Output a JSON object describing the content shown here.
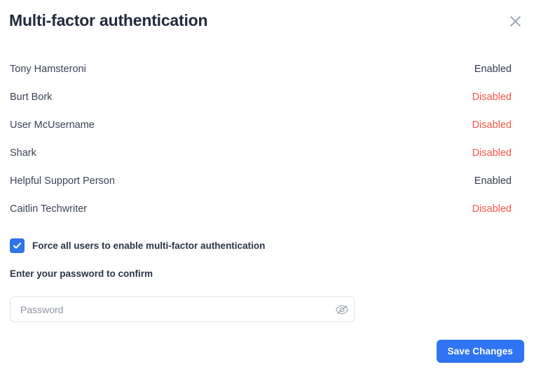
{
  "dialog": {
    "title": "Multi-factor authentication",
    "close_icon": "close-icon"
  },
  "users": [
    {
      "name": "Tony Hamsteroni",
      "status": "Enabled",
      "state": "enabled"
    },
    {
      "name": "Burt Bork",
      "status": "Disabled",
      "state": "disabled"
    },
    {
      "name": "User McUsername",
      "status": "Disabled",
      "state": "disabled"
    },
    {
      "name": "Shark",
      "status": "Disabled",
      "state": "disabled"
    },
    {
      "name": "Helpful Support Person",
      "status": "Enabled",
      "state": "enabled"
    },
    {
      "name": "Caitlin Techwriter",
      "status": "Disabled",
      "state": "disabled"
    }
  ],
  "force_mfa": {
    "label": "Force all users to enable multi-factor authentication",
    "checked": true,
    "icon": "checkmark-icon"
  },
  "password": {
    "label": "Enter your password to confirm",
    "value": "",
    "placeholder": "Password",
    "toggle_icon": "eye-off-icon"
  },
  "footer": {
    "save_label": "Save Changes"
  },
  "colors": {
    "accent": "#2f74f2",
    "checkbox": "#2f74e8",
    "title": "#222b3c",
    "text": "#3a4355",
    "enabled": "#353d4d",
    "disabled": "#f4564a",
    "border": "#dfe3eb",
    "placeholder": "#8d93a3",
    "icon_gray": "#9aa1b1"
  }
}
